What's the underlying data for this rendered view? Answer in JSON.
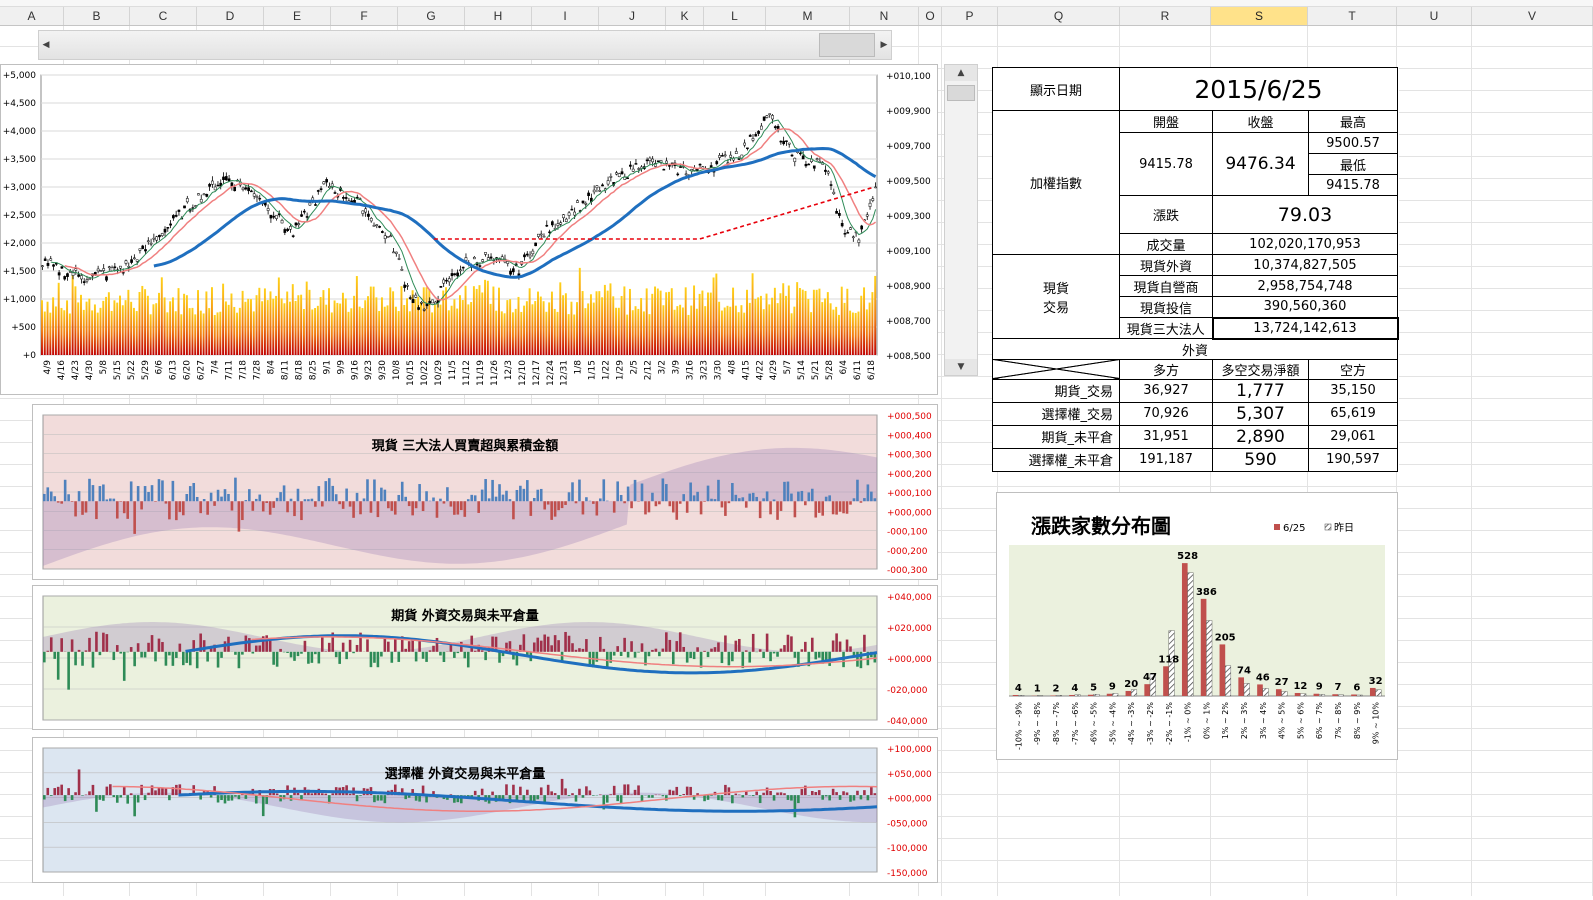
{
  "columns": [
    "A",
    "B",
    "C",
    "D",
    "E",
    "F",
    "G",
    "H",
    "I",
    "J",
    "K",
    "L",
    "M",
    "N",
    "O",
    "P",
    "Q",
    "R",
    "S",
    "T",
    "U",
    "V"
  ],
  "selected_column": "S",
  "main_chart": {
    "left_axis": [
      "+5,000",
      "+4,500",
      "+4,000",
      "+3,500",
      "+3,000",
      "+2,500",
      "+2,000",
      "+1,500",
      "+1,000",
      "+500",
      "+0"
    ],
    "right_axis": [
      "+010,100",
      "+009,900",
      "+009,700",
      "+009,500",
      "+009,300",
      "+009,100",
      "+008,900",
      "+008,700",
      "+008,500"
    ],
    "x_labels": [
      "4/9",
      "4/16",
      "4/23",
      "4/30",
      "5/8",
      "5/15",
      "5/22",
      "5/29",
      "6/6",
      "6/13",
      "6/20",
      "6/27",
      "7/4",
      "7/11",
      "7/18",
      "7/28",
      "8/4",
      "8/11",
      "8/18",
      "8/25",
      "9/1",
      "9/9",
      "9/16",
      "9/23",
      "9/30",
      "10/8",
      "10/15",
      "10/22",
      "10/29",
      "11/5",
      "11/12",
      "11/19",
      "11/26",
      "12/3",
      "12/10",
      "12/17",
      "12/24",
      "12/31",
      "1/8",
      "1/15",
      "1/22",
      "1/29",
      "2/5",
      "2/12",
      "3/2",
      "3/9",
      "3/16",
      "3/23",
      "3/30",
      "4/8",
      "4/15",
      "4/22",
      "4/29",
      "5/7",
      "5/14",
      "5/21",
      "5/28",
      "6/4",
      "6/11",
      "6/18"
    ]
  },
  "panel_spot": {
    "title": "現貨 三大法人買賣超與累積金額",
    "right_axis": [
      "+000,500",
      "+000,400",
      "+000,300",
      "+000,200",
      "+000,100",
      "+000,000",
      "-000,100",
      "-000,200",
      "-000,300"
    ]
  },
  "panel_fut": {
    "title": "期貨 外資交易與未平倉量",
    "right_axis": [
      "+040,000",
      "+020,000",
      "+000,000",
      "-020,000",
      "-040,000"
    ]
  },
  "panel_opt": {
    "title": "選擇權 外資交易與未平倉量",
    "right_axis": [
      "+100,000",
      "+050,000",
      "+000,000",
      "-050,000",
      "-100,000",
      "-150,000"
    ]
  },
  "table": {
    "display_date_label": "顯示日期",
    "display_date": "2015/6/25",
    "open_label": "開盤",
    "close_label": "收盤",
    "high_label": "最高",
    "low_label": "最低",
    "taiex_label": "加權指數",
    "open": "9415.78",
    "close": "9476.34",
    "high": "9500.57",
    "low": "9415.78",
    "change_label": "漲跌",
    "change": "79.03",
    "volume_label": "成交量",
    "volume": "102,020,170,953",
    "spot_label": "現貨\n交易",
    "foreign_label": "現貨外資",
    "foreign": "10,374,827,505",
    "dealer_label": "現貨自營商",
    "dealer": "2,958,754,748",
    "trust_label": "現貨投信",
    "trust": "390,560,360",
    "three_label": "現貨三大法人",
    "three": "13,724,142,613",
    "fi_label": "外資",
    "long_label": "多方",
    "net_label": "多空交易淨額",
    "short_label": "空方",
    "rows": [
      {
        "label": "期貨_交易",
        "long": "36,927",
        "net": "1,777",
        "short": "35,150"
      },
      {
        "label": "選擇權_交易",
        "long": "70,926",
        "net": "5,307",
        "short": "65,619"
      },
      {
        "label": "期貨_未平倉",
        "long": "31,951",
        "net": "2,890",
        "short": "29,061"
      },
      {
        "label": "選擇權_未平倉",
        "long": "191,187",
        "net": "590",
        "short": "190,597"
      }
    ]
  },
  "dist_chart": {
    "title": "漲跌家數分布圖",
    "legend": [
      "6/25",
      "昨日"
    ]
  },
  "chart_data": {
    "type": "bar",
    "title": "漲跌家數分布圖",
    "categories": [
      "-10% ~ -9%",
      "-9% ~ -8%",
      "-8% ~ -7%",
      "-7% ~ -6%",
      "-6% ~ -5%",
      "-5% ~ -4%",
      "-4% ~ -3%",
      "-3% ~ -2%",
      "-2% ~ -1%",
      "-1% ~ 0%",
      "0% ~ 1%",
      "1% ~ 2%",
      "2% ~ 3%",
      "3% ~ 4%",
      "4% ~ 5%",
      "5% ~ 6%",
      "6% ~ 7%",
      "7% ~ 8%",
      "8% ~ 9%",
      "9% ~ 10%"
    ],
    "series": [
      {
        "name": "6/25",
        "values": [
          4,
          1,
          2,
          4,
          5,
          9,
          20,
          47,
          118,
          528,
          386,
          205,
          74,
          46,
          27,
          12,
          9,
          7,
          6,
          32
        ],
        "color": "#c0504d"
      },
      {
        "name": "昨日",
        "values": [
          3,
          2,
          3,
          5,
          7,
          10,
          25,
          90,
          260,
          490,
          300,
          120,
          50,
          30,
          18,
          9,
          6,
          5,
          4,
          25
        ],
        "pattern": "hatched"
      }
    ],
    "ylim": [
      0,
      600
    ]
  },
  "colors": {
    "blue_ma": "#1f6fbf",
    "pink_ma": "#f08080",
    "green_ma": "#2e8b57",
    "red_dash": "#e8000b",
    "vol_top": "#ffd21a",
    "vol_bottom": "#c00000"
  }
}
